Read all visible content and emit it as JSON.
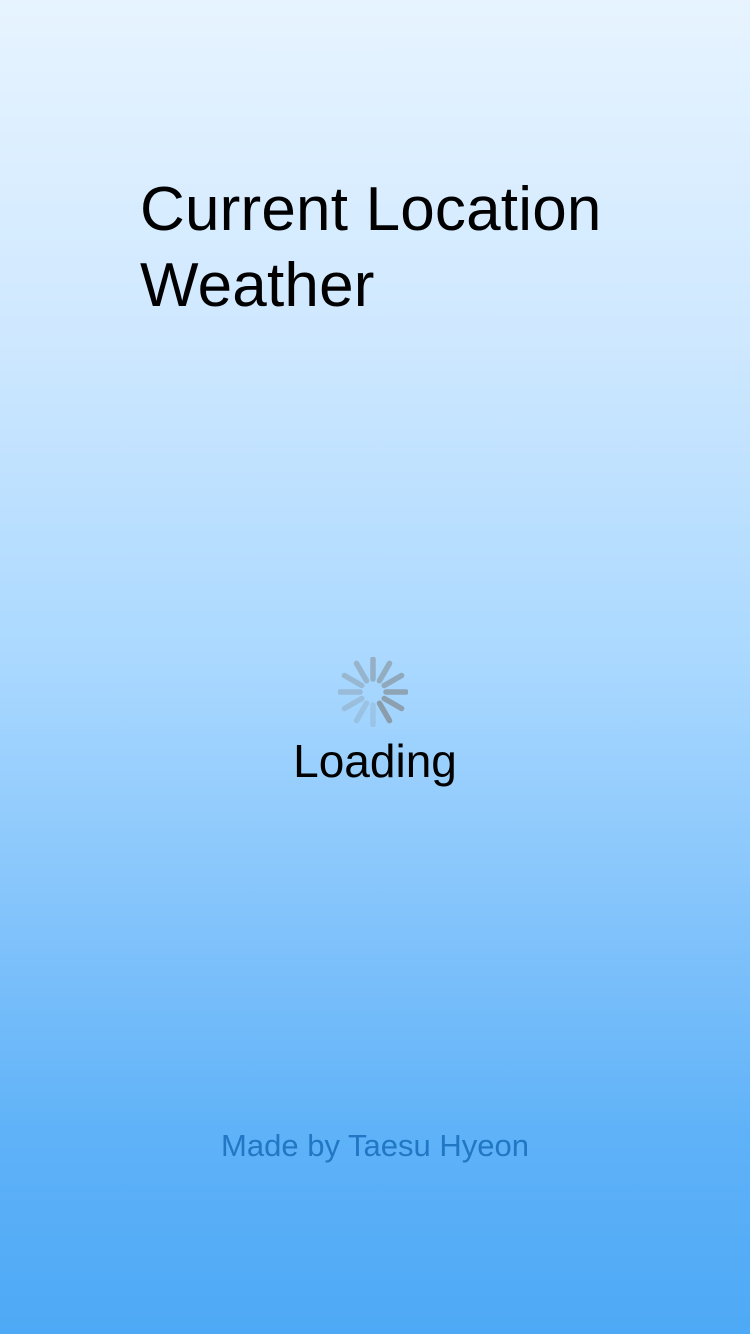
{
  "title": {
    "line1": "Current Location",
    "line2": "Weather"
  },
  "loading": {
    "label": "Loading",
    "icon": "activity-spinner-icon"
  },
  "footer": {
    "credit": "Made by Taesu Hyeon"
  },
  "colors": {
    "background_top": "#e7f4ff",
    "background_bottom": "#4ea9f6",
    "text": "#000000",
    "footer_text": "#2277c4",
    "spinner": "#8a9aa6"
  }
}
